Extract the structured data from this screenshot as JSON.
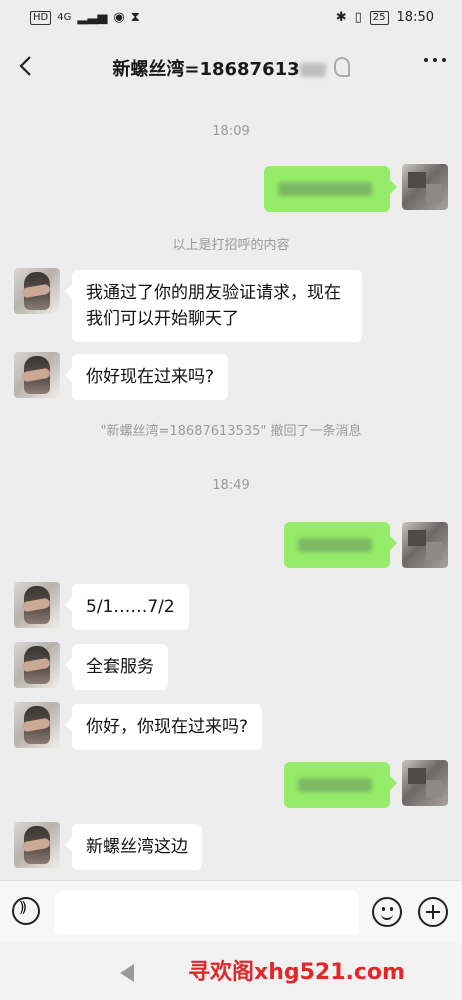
{
  "status_bar": {
    "network_badge": "HD",
    "signal_label": "4G",
    "battery_level": "25",
    "time": "18:50"
  },
  "header": {
    "title": "新螺丝湾=18687613"
  },
  "messages": [
    {
      "type": "time",
      "text": "18:09"
    },
    {
      "type": "sent",
      "text": "",
      "blurred": true
    },
    {
      "type": "system",
      "text": "以上是打招呼的内容"
    },
    {
      "type": "received",
      "text": "我通过了你的朋友验证请求，现在我们可以开始聊天了"
    },
    {
      "type": "received",
      "text": "你好现在过来吗?"
    },
    {
      "type": "system",
      "text": "\"新螺丝湾=18687613535\" 撤回了一条消息"
    },
    {
      "type": "time",
      "text": "18:49"
    },
    {
      "type": "sent",
      "text": "",
      "blurred": true
    },
    {
      "type": "received",
      "text": "5/1……7/2"
    },
    {
      "type": "received",
      "text": "全套服务"
    },
    {
      "type": "received",
      "text": "你好，你现在过来吗?"
    },
    {
      "type": "sent",
      "text": "",
      "blurred": true
    },
    {
      "type": "received",
      "text": "新螺丝湾这边"
    }
  ],
  "input_bar": {
    "placeholder": "",
    "value": ""
  },
  "watermark": "寻欢阁xhg521.com"
}
